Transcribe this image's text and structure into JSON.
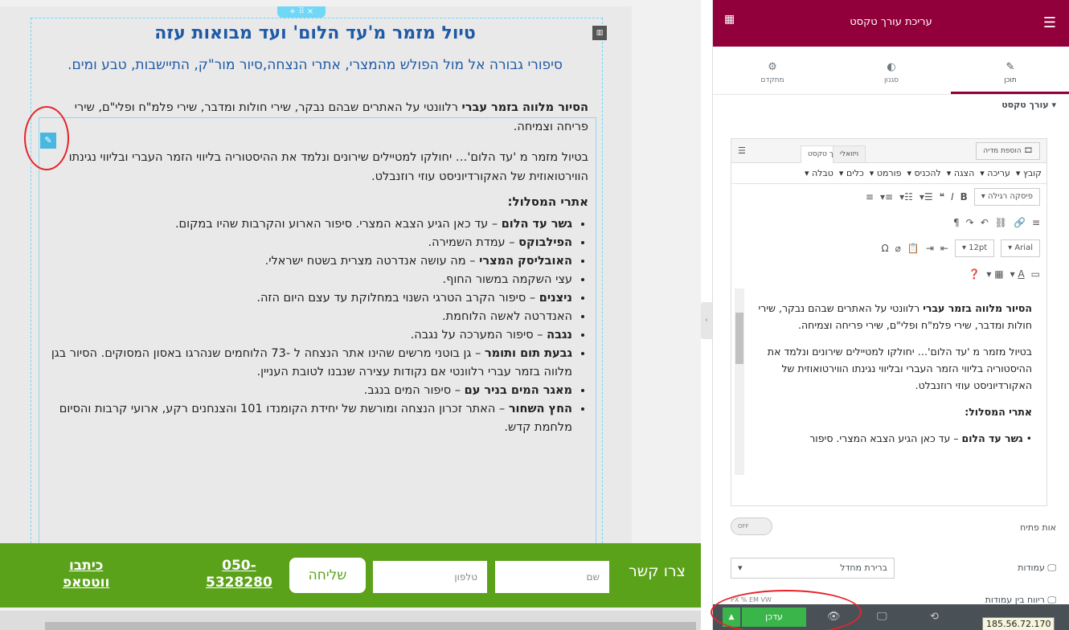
{
  "page": {
    "title": "טיול מזמר מ'עד הלום' ועד מבואות עזה",
    "subtitle": "סיפורי גבורה אל מול הפולש מהמצרי, אתרי הנצחה,סיור מור\"ק, התיישבות, טבע ומים.",
    "para1_bold": "הסיור מלווה בזמר עברי",
    "para1_rest": " רלוונטי על האתרים שבהם נבקר, שירי חולות ומדבר, שירי פלמ\"ח ופלי\"ם, שירי פריחה וצמיחה.",
    "para2": "בטיול מזמר מ 'עד הלום'… יחולקו למטיילים שירונים ונלמד את ההיסטוריה בליווי הזמר העברי ובליווי נגינתו הווירטואוזית של האקורדיוניסט עוזי רוזנבלט.",
    "route_heading": "אתרי המסלול:",
    "route_items": [
      {
        "bold": "גשר עד הלום",
        "rest": " – עד כאן הגיע הצבא המצרי. סיפור הארוע והקרבות שהיו במקום."
      },
      {
        "bold": "הפילבוקס",
        "rest": " – עמדת השמירה."
      },
      {
        "bold": "האובליסק המצרי",
        "rest": " – מה עושה אנדרטה מצרית בשטח ישראלי."
      },
      {
        "bold": "",
        "rest": "עצי השקמה במשור החוף."
      },
      {
        "bold": "ניצנים",
        "rest": " – סיפור הקרב הטרגי השנוי במחלוקת עד עצם היום הזה."
      },
      {
        "bold": "",
        "rest": "האנדרטה לאשה הלוחמת."
      },
      {
        "bold": "נגבה",
        "rest": " – סיפור המערכה על נגבה."
      },
      {
        "bold": "גבעת תום ותומר",
        "rest": " – גן בוטני מרשים שהינו אתר הנצחה ל -73 הלוחמים שנהרגו באסון המסוקים. הסיור בגן מלווה בזמר עברי רלוונטי אם נקודות עצירה שנבנו לטובת העניין."
      },
      {
        "bold": "מאגר המים בניר עם",
        "rest": " – סיפור המים בנגב."
      },
      {
        "bold": "החץ השחור",
        "rest": " – האתר זכרון הנצחה ומורשת של יחידת הקומנדו 101 והצנחנים רקע, ארועי קרבות והסיום מלחמת קדש."
      }
    ]
  },
  "footer": {
    "contact_label": "צרו קשר",
    "name_placeholder": "שם",
    "phone_placeholder": "טלפון",
    "send_label": "שליחה",
    "phone_line1": "050-",
    "phone_line2": "5328280",
    "wa_line1": "כיתבו",
    "wa_line2": "ווטסאפ"
  },
  "panel": {
    "title": "עריכת עורך טקסט",
    "tabs": [
      {
        "label": "תוכן",
        "icon": "pencil-icon"
      },
      {
        "label": "סגנון",
        "icon": "contrast-icon"
      },
      {
        "label": "מתקדם",
        "icon": "gear-icon"
      }
    ],
    "section_title": "עורך טקסט",
    "add_media": "הוספת מדיה",
    "tab_visual": "ויזואלי",
    "tab_text": "עורך טקסט",
    "menu": [
      "קובץ",
      "עריכה",
      "הצגה",
      "להכניס",
      "פורמט",
      "כלים",
      "טבלה"
    ],
    "format_select": "פיסקה רגילה",
    "font_select": "Arial",
    "size_select": "12pt",
    "editor_p1_bold": "הסיור מלווה בזמר עברי",
    "editor_p1_rest": " רלוונטי על האתרים שבהם נבקר, שירי חולות ומדבר, שירי פלמ\"ח ופלי\"ם, שירי פריחה וצמיחה.",
    "editor_p2": "בטיול מזמר מ 'עד הלום'… יחולקו למטיילים שירונים ונלמד את ההיסטוריה בליווי הזמר העברי ובליווי נגינתו הווירטואוזית של האקורדיוניסט עוזי רוזנבלט.",
    "editor_p3": "אתרי המסלול:",
    "editor_p4_bold": "גשר עד הלום",
    "editor_p4_rest": " – עד כאן הגיע הצבא המצרי. סיפור",
    "dropcap_label": "אות פתיח",
    "toggle_off": "OFF",
    "columns_label": "עמודות",
    "columns_value": "ברירת מחדל",
    "gap_label": "ריווח בין עמודות",
    "units": "PX % EM VW",
    "update_label": "עדכן",
    "ip_tooltip": "185.56.72.170"
  },
  "colors": {
    "brand": "#92003b",
    "footer_green": "#5ba21b",
    "heading_blue": "#1f5aa6",
    "update_green": "#39b54a"
  }
}
